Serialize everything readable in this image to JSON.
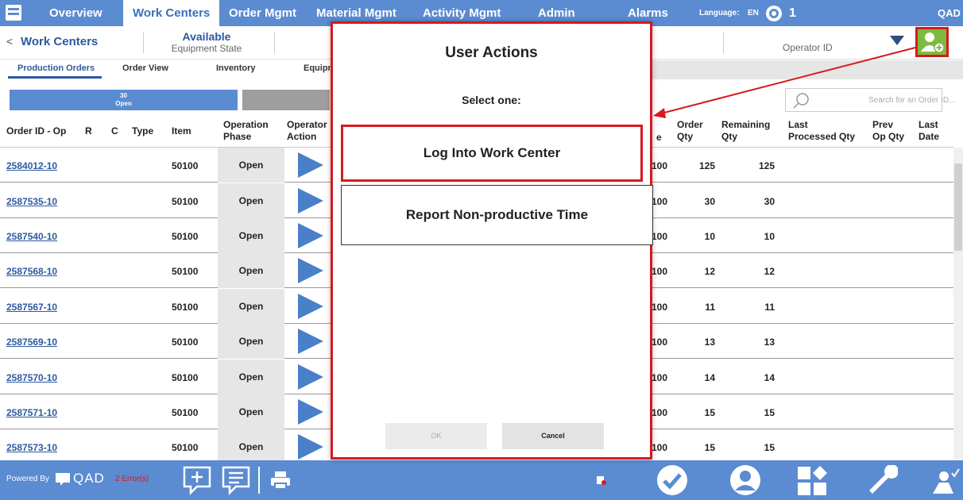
{
  "nav": {
    "tabs": [
      "Overview",
      "Work Centers",
      "Order Mgmt",
      "Material Mgmt",
      "Activity Mgmt",
      "Admin",
      "Alarms"
    ],
    "active_tab": "Work Centers",
    "language_label": "Language:",
    "language_code": "EN",
    "user_count": "1",
    "brand": "QAD"
  },
  "header": {
    "back": "<",
    "work_centers": "Work Centers",
    "state_value": "Available",
    "state_label": "Equipment State",
    "operator_placeholder": "Operator ID"
  },
  "subtabs": [
    "Production Orders",
    "Order View",
    "Inventory",
    "Equipm"
  ],
  "status": {
    "open_count": "30",
    "open_label": "Open"
  },
  "search": {
    "placeholder": "Search for an Order ID..."
  },
  "table": {
    "headers": {
      "order_id": "Order ID - Op",
      "r": "R",
      "c": "C",
      "type": "Type",
      "item": "Item",
      "phase": [
        "Operation",
        "Phase"
      ],
      "action": [
        "Operator",
        "Action"
      ],
      "e": "e",
      "order_qty": [
        "Order",
        "Qty"
      ],
      "remaining_qty": [
        "Remaining",
        "Qty"
      ],
      "last_processed": [
        "Last",
        "Processed Qty"
      ],
      "prev_op": [
        "Prev",
        "Op Qty"
      ],
      "last_date": [
        "Last",
        "Date"
      ]
    },
    "rows": [
      {
        "id": "2584012-10",
        "item": "50100",
        "phase": "Open",
        "e": "100",
        "order_qty": "125",
        "remaining_qty": "125"
      },
      {
        "id": "2587535-10",
        "item": "50100",
        "phase": "Open",
        "e": "100",
        "order_qty": "30",
        "remaining_qty": "30"
      },
      {
        "id": "2587540-10",
        "item": "50100",
        "phase": "Open",
        "e": "100",
        "order_qty": "10",
        "remaining_qty": "10"
      },
      {
        "id": "2587568-10",
        "item": "50100",
        "phase": "Open",
        "e": "100",
        "order_qty": "12",
        "remaining_qty": "12"
      },
      {
        "id": "2587567-10",
        "item": "50100",
        "phase": "Open",
        "e": "100",
        "order_qty": "11",
        "remaining_qty": "11"
      },
      {
        "id": "2587569-10",
        "item": "50100",
        "phase": "Open",
        "e": "100",
        "order_qty": "13",
        "remaining_qty": "13"
      },
      {
        "id": "2587570-10",
        "item": "50100",
        "phase": "Open",
        "e": "100",
        "order_qty": "14",
        "remaining_qty": "14"
      },
      {
        "id": "2587571-10",
        "item": "50100",
        "phase": "Open",
        "e": "100",
        "order_qty": "15",
        "remaining_qty": "15"
      },
      {
        "id": "2587573-10",
        "item": "50100",
        "phase": "Open",
        "e": "100",
        "order_qty": "15",
        "remaining_qty": "15"
      }
    ]
  },
  "footer": {
    "powered_by": "Powered By",
    "brand": "QAD",
    "errors": "2 Error(s)"
  },
  "modal": {
    "title": "User Actions",
    "subtitle": "Select one:",
    "option1": "Log Into Work Center",
    "option2": "Report Non-productive Time",
    "ok": "OK",
    "cancel": "Cancel"
  },
  "colors": {
    "nav_blue": "#5b8bd1",
    "highlight_red": "#d71920",
    "link_blue": "#2d5aa0",
    "add_user_green": "#7dbb3e"
  }
}
